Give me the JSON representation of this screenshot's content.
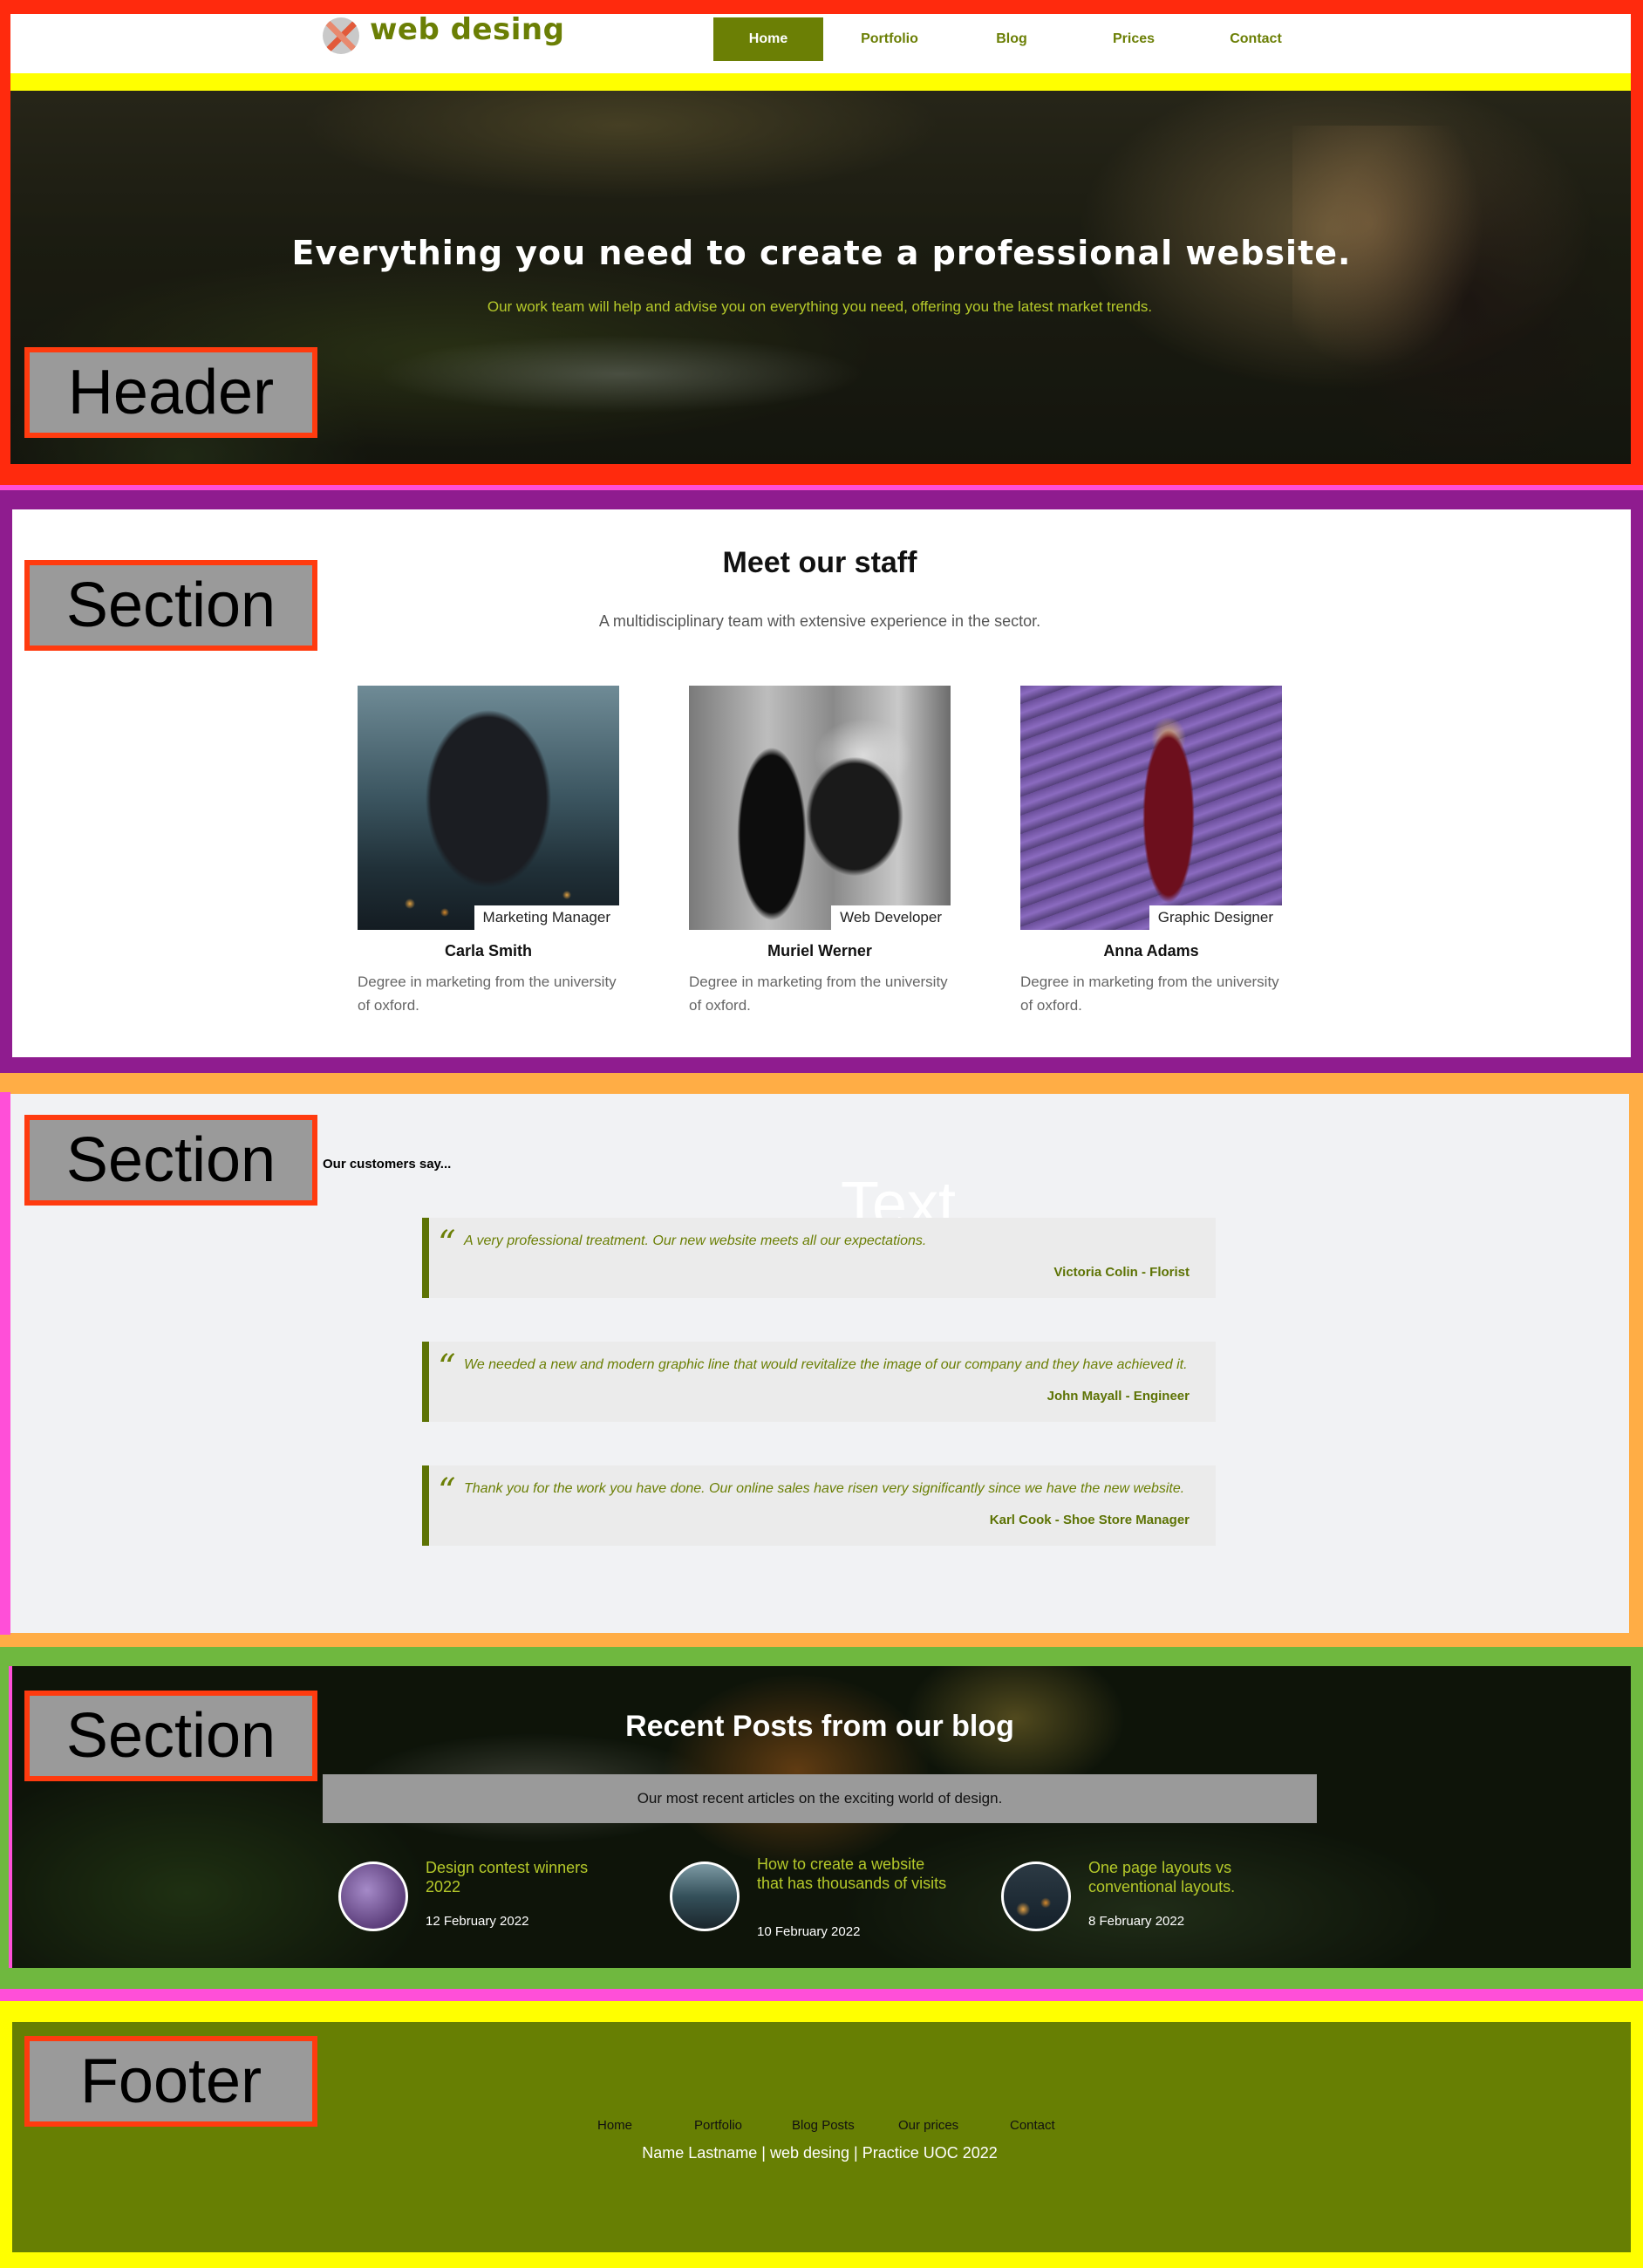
{
  "logo": {
    "text": "web desing",
    "icon": "logo-icon"
  },
  "nav": {
    "items": [
      {
        "label": "Home",
        "active": true
      },
      {
        "label": "Portfolio",
        "active": false
      },
      {
        "label": "Blog",
        "active": false
      },
      {
        "label": "Prices",
        "active": false
      },
      {
        "label": "Contact",
        "active": false
      }
    ]
  },
  "hero": {
    "title": "Everything you need to create a professional website.",
    "subtitle": "Our work team will help and advise you on everything you need, offering you the latest market trends."
  },
  "overlays": {
    "header": "Header",
    "section": "Section",
    "footer": "Footer",
    "text": "Text"
  },
  "staff": {
    "title": "Meet our staff",
    "subtitle": "A multidisciplinary team with extensive experience in the sector.",
    "members": [
      {
        "name": "Carla Smith",
        "role": "Marketing Manager",
        "description": "Degree in marketing from the university of oxford."
      },
      {
        "name": "Muriel Werner",
        "role": "Web Developer",
        "description": "Degree in marketing from the university of oxford."
      },
      {
        "name": "Anna Adams",
        "role": "Graphic Designer",
        "description": "Degree in marketing from the university of oxford."
      }
    ]
  },
  "testimonials": {
    "heading": "Our customers say...",
    "items": [
      {
        "quote": "A very professional treatment. Our new website meets all our expectations.",
        "author": "Victoria Colin - Florist"
      },
      {
        "quote": "We needed a new and modern graphic line that would revitalize the image of our company and they have achieved it.",
        "author": "John Mayall - Engineer"
      },
      {
        "quote": "Thank you for the work you have done. Our online sales have risen very significantly since we have the new website.",
        "author": "Karl Cook - Shoe Store Manager"
      }
    ]
  },
  "blog": {
    "title": "Recent Posts from our blog",
    "subtitle": "Our most recent articles on the exciting world of design.",
    "posts": [
      {
        "title": "Design contest winners 2022",
        "date": "12 February 2022"
      },
      {
        "title": "How to create a website that has thousands of visits",
        "date": "10 February 2022"
      },
      {
        "title": "One page layouts vs conventional layouts.",
        "date": "8 February 2022"
      }
    ]
  },
  "footer": {
    "nav": [
      "Home",
      "Portfolio",
      "Blog Posts",
      "Our prices",
      "Contact"
    ],
    "copyright": "Name Lastname | web desing | Practice UOC 2022"
  },
  "colors": {
    "brand_green": "#6b7f05",
    "accent_yellow_green": "#b5c92a",
    "header_frame": "#ff2a0d",
    "staff_frame": "#8f1c8f",
    "testimonials_frame": "#ffad45",
    "blog_frame": "#6fb83f",
    "footer_frame": "#ffff00",
    "marker_pink": "#ff4fd8"
  }
}
